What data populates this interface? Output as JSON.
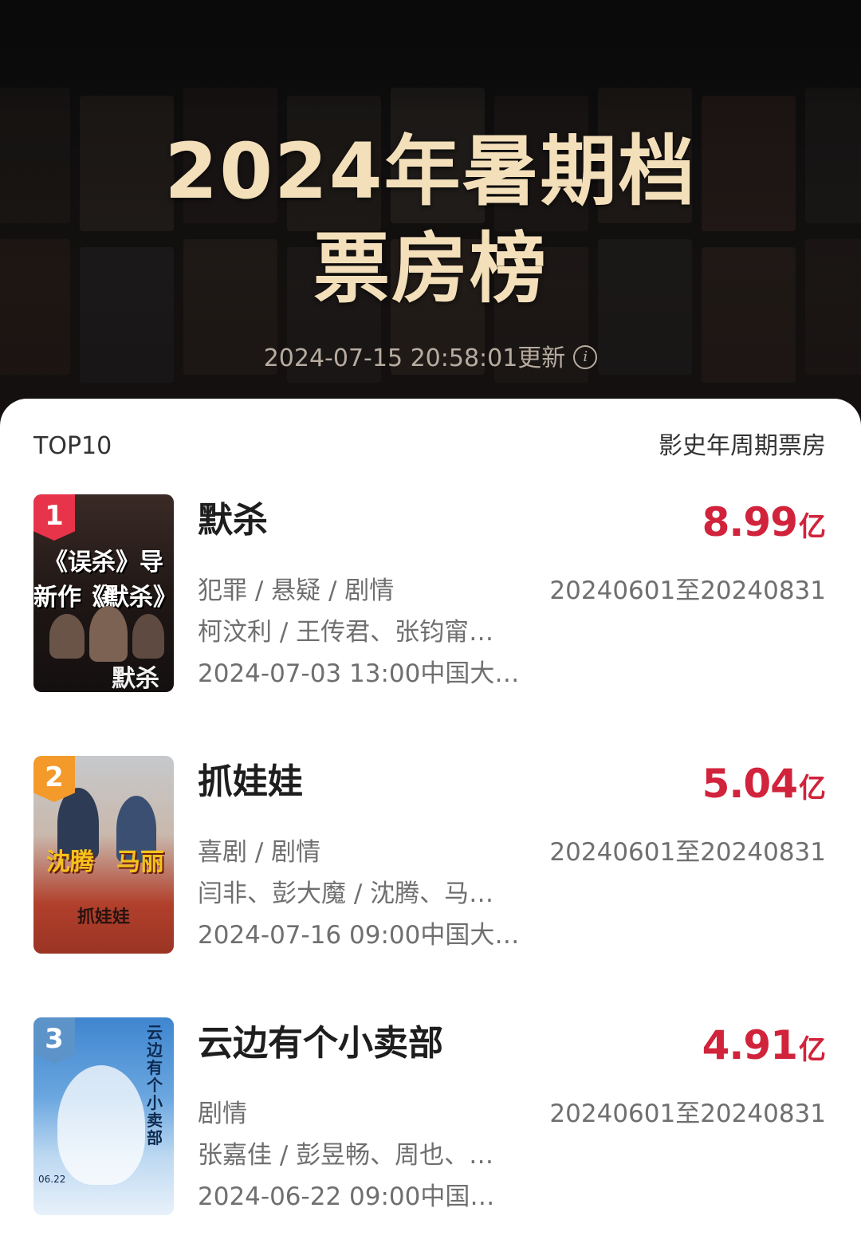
{
  "header": {
    "title_line1": "2024年暑期档",
    "title_line2": "票房榜",
    "update_text": "2024-07-15 20:58:01更新",
    "info_icon_glyph": "i"
  },
  "list_header": {
    "left": "TOP10",
    "right": "影史年周期票房"
  },
  "movies": [
    {
      "rank": "1",
      "title": "默杀",
      "genre": "犯罪 / 悬疑 / 剧情",
      "cast": "柯汶利 / 王传君、张钧甯…",
      "release": "2024-07-03 13:00中国大…",
      "box_office": "8.99",
      "unit": "亿",
      "period": "20240601至20240831",
      "poster_text": [
        "《误杀》导演",
        "新作《默杀》",
        "默杀"
      ],
      "badge_color": "#e8344a",
      "poster_colors": [
        "#3a2a26",
        "#141010"
      ]
    },
    {
      "rank": "2",
      "title": "抓娃娃",
      "genre": "喜剧 / 剧情",
      "cast": "闫非、彭大魔 / 沈腾、马…",
      "release": "2024-07-16 09:00中国大…",
      "box_office": "5.04",
      "unit": "亿",
      "period": "20240601至20240831",
      "poster_text": [
        "沈腾",
        "马丽",
        "抓娃娃"
      ],
      "badge_color": "#f39a2b",
      "poster_colors": [
        "#c6c9cc",
        "#b1402c"
      ]
    },
    {
      "rank": "3",
      "title": "云边有个小卖部",
      "genre": "剧情",
      "cast": "张嘉佳 / 彭昱畅、周也、…",
      "release": "2024-06-22 09:00中国…",
      "box_office": "4.91",
      "unit": "亿",
      "period": "20240601至20240831",
      "poster_text": [
        "云边有个小卖部",
        "06.22"
      ],
      "badge_color": "#5c93c9",
      "poster_colors": [
        "#3f86d0",
        "#bcd8f1"
      ]
    }
  ]
}
